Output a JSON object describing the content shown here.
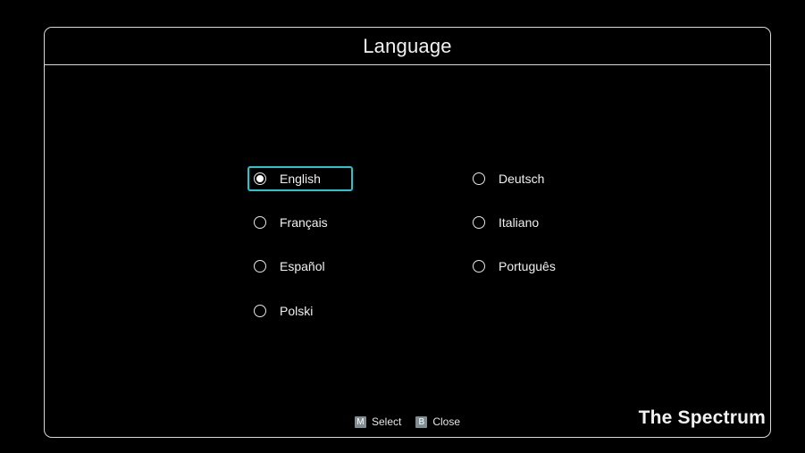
{
  "dialog": {
    "title": "Language"
  },
  "languages": [
    {
      "label": "English",
      "selected": true,
      "focused": true
    },
    {
      "label": "Deutsch",
      "selected": false,
      "focused": false
    },
    {
      "label": "Français",
      "selected": false,
      "focused": false
    },
    {
      "label": "Italiano",
      "selected": false,
      "focused": false
    },
    {
      "label": "Español",
      "selected": false,
      "focused": false
    },
    {
      "label": "Português",
      "selected": false,
      "focused": false
    },
    {
      "label": "Polski",
      "selected": false,
      "focused": false
    }
  ],
  "footer": {
    "select_key": "M",
    "select_label": "Select",
    "close_key": "B",
    "close_label": "Close",
    "brand": "The Spectrum"
  },
  "colors": {
    "focus_border": "#1ec8d0",
    "key_badge": "#7f8e93",
    "frame": "#d9d9d9"
  }
}
